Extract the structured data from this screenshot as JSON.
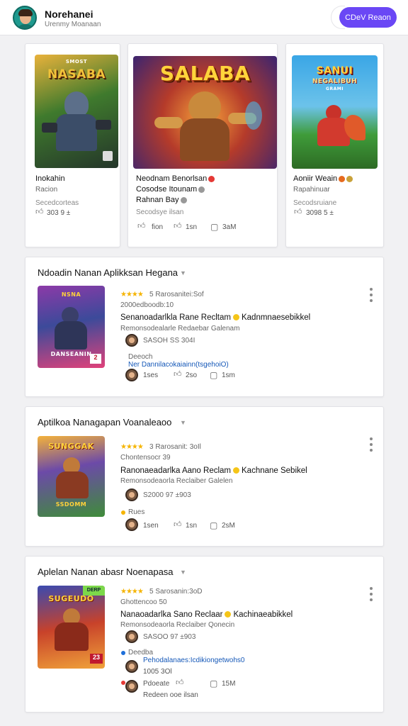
{
  "header": {
    "name": "Norehanei",
    "subtitle": "Urenmy Moanaan",
    "button_label": "CDeV Reaon"
  },
  "featured": [
    {
      "cover_title": "NASABA",
      "cover_badge": "SMOST",
      "title": "Inokahin",
      "sub": "Racion",
      "extra": "Secedcorteas",
      "stats": "303  9 ±"
    },
    {
      "cover_title": "SALABA",
      "title": "Neodnam Benorlsan",
      "line2": "Cosodse Itounam",
      "line3": "Rahnan Bay",
      "extra": "Secodsye ilsan",
      "stat1": "fion",
      "stat2": "1sn",
      "stat3": "3aM"
    },
    {
      "cover_title": "SANUI",
      "cover_sub": "NEGALIBUH",
      "cover_badge": "GRAMI",
      "title": "Aoniir Weain",
      "sub": "Rapahinuar",
      "extra": "Secodsruiane",
      "stats": "3098  5 ±"
    }
  ],
  "sections": [
    {
      "title": "Ndoadin Nanan Aplikksan Hegana",
      "cover_title": "NSNA",
      "cover_sub": "DANSEANIN",
      "cover_badge": "2",
      "rating_text": "5 Rarosanitei:Sof",
      "meta": "2000edboodb:10",
      "main": "Senanoadarlkla Rane Recltam",
      "main_tail": "Kadnmnaesebikkel",
      "sub": "Remonsodealarle Redaebar Galenam",
      "avatar_row1": "SASOH SS   304I",
      "status_label": "Deeoch",
      "link": "Ner Dannilacokaiainn(tsgehoiO)",
      "stat1": "1ses",
      "stat2": "2so",
      "stat3": "1sm"
    },
    {
      "title": "Aptilkoa Nanagapan Voanaleaoo",
      "cover_title": "SUNGGAK",
      "cover_sub": "SSDOMM",
      "rating_text": "3 Rarosanit: 3oIl",
      "meta": "Chontensocr 39",
      "main": "Ranonaeadarlka Aano Reclam",
      "main_tail": "Kachnane Sebikel",
      "sub": "Remonsodeaorla Reclaiber Galelen",
      "avatar_row1": "S2000  97 ±903",
      "status_label": "Rues",
      "stat1": "1sen",
      "stat2": "1sn",
      "stat3": "2sM"
    },
    {
      "title": "Aplelan Nanan abasr Noenapasa",
      "cover_title": "SUGEUDO",
      "cover_badge": "23",
      "cover_tag": "DERP",
      "rating_text": "5 Sarosanin:3oD",
      "meta": "Ghottencoo 50",
      "main": "Nanaoadarlka Sano Reclaar",
      "main_tail": "Kachinaeabikkel",
      "sub": "Remonsodeaorla Reclaiber Qonecin",
      "avatar_row1": "SASOO  97 ±903",
      "status_label": "Deedba",
      "link": "Pehodalanaes:Icdikiongetwohs0",
      "row_a": "1005   3Ol",
      "row_b_label": "Pdoeate",
      "stat3": "15M",
      "footer": "Redeen  ooe  ilsan"
    }
  ],
  "colors": {
    "accent": "#6a47f5",
    "star": "#f5b400",
    "link": "#1558b8"
  },
  "icons": [
    "like-icon",
    "share-icon",
    "comment-icon",
    "kebab-menu-icon",
    "chevron-down-icon"
  ]
}
